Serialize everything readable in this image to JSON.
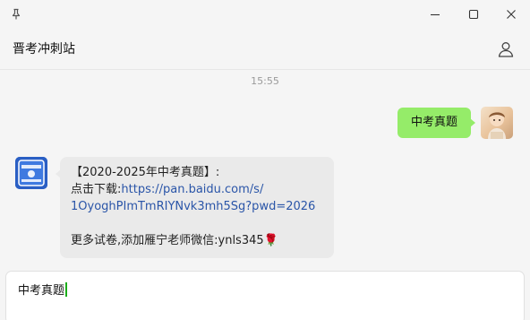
{
  "window": {
    "title": "晋考冲刺站",
    "controls": [
      "minimize",
      "maximize",
      "close"
    ]
  },
  "chat": {
    "timestamp": "15:55",
    "messages": [
      {
        "side": "right",
        "text": "中考真题",
        "bubble_color": "#95ec69"
      },
      {
        "side": "left",
        "line1": "【2020-2025年中考真题】:",
        "line2_prefix": "点击下载:",
        "link_part1": "https://pan.baidu.com/s/",
        "link_part2": "1OyoghPImTmRIYNvk3mh5Sg?pwd=2026",
        "line4_text": "更多试卷,添加雁宁老师微信:ynls345",
        "emoji": "🌹"
      }
    ]
  },
  "input": {
    "value": "中考真题"
  },
  "colors": {
    "accent_green": "#95ec69",
    "link": "#2a55a8",
    "caret": "#1aad19"
  },
  "icons": [
    "pin-icon",
    "minimize-icon",
    "maximize-icon",
    "close-icon",
    "user-icon"
  ]
}
